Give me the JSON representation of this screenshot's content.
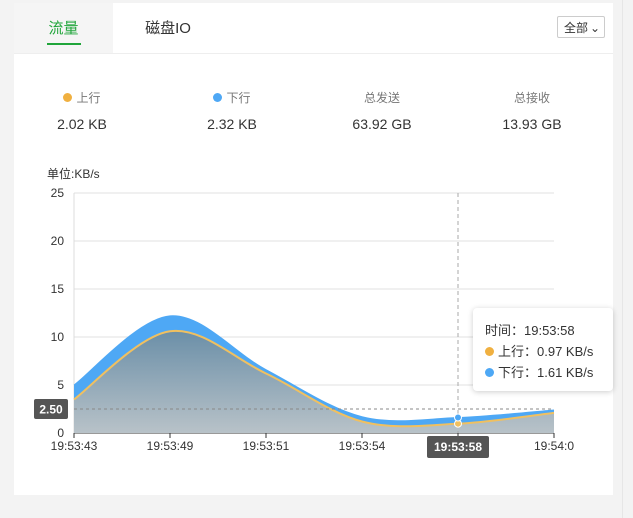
{
  "tabs": [
    {
      "label": "流量",
      "active": true
    },
    {
      "label": "磁盘IO",
      "active": false
    }
  ],
  "filter": {
    "selected": "全部"
  },
  "stats": [
    {
      "label": "上行",
      "value": "2.02 KB",
      "color": "#f0b040"
    },
    {
      "label": "下行",
      "value": "2.32 KB",
      "color": "#4ea8f5"
    },
    {
      "label": "总发送",
      "value": "63.92 GB"
    },
    {
      "label": "总接收",
      "value": "13.93 GB"
    }
  ],
  "chart_data": {
    "type": "area",
    "ylabel": "单位:KB/s",
    "ylim": [
      0,
      25
    ],
    "yticks": [
      "0",
      "5",
      "10",
      "15",
      "20",
      "25"
    ],
    "x": [
      "19:53:43",
      "19:53:49",
      "19:53:51",
      "19:53:54",
      "19:53:58",
      "19:54:0"
    ],
    "series": [
      {
        "name": "上行",
        "color": "#f0c060",
        "values": [
          3.5,
          10.6,
          6.2,
          1.2,
          0.97,
          2.1
        ]
      },
      {
        "name": "下行",
        "color": "#4ea8f5",
        "values": [
          5.0,
          12.2,
          6.6,
          1.7,
          1.61,
          2.4
        ]
      }
    ],
    "crosshair": {
      "x_label": "19:53:58",
      "y_label": "2.50"
    },
    "tooltip": {
      "time_label": "时间：19:53:58",
      "lines": [
        "上行：0.97 KB/s",
        "下行：1.61 KB/s"
      ]
    }
  }
}
